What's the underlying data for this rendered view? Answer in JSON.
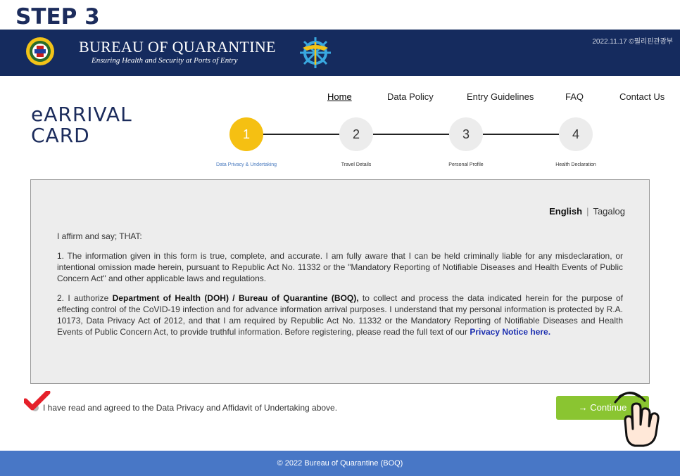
{
  "step_title": "STEP 3",
  "banner": {
    "name": "BUREAU OF QUARANTINE",
    "tagline": "Ensuring Health and Security at Ports of Entry",
    "date": "2022.11.17 ©필리핀관광부"
  },
  "brand": {
    "line1": "eARRIVAL",
    "line2": "CARD"
  },
  "nav": {
    "home": "Home",
    "data_policy": "Data Policy",
    "entry_guidelines": "Entry Guidelines",
    "faq": "FAQ",
    "contact": "Contact Us"
  },
  "stepper": {
    "steps": [
      {
        "num": "1",
        "label": "Data Privacy & Undertaking",
        "active": true
      },
      {
        "num": "2",
        "label": "Travel Details",
        "active": false
      },
      {
        "num": "3",
        "label": "Personal Profile",
        "active": false
      },
      {
        "num": "4",
        "label": "Health Declaration",
        "active": false
      }
    ]
  },
  "panel": {
    "lang_en": "English",
    "lang_sep": "|",
    "lang_tl": "Tagalog",
    "intro": "I affirm and say; THAT:",
    "para1": "1. The information given in this form is true, complete, and accurate. I am fully aware that I can be held criminally liable for any misdeclaration, or intentional omission made herein, pursuant to Republic Act No. 11332 or the \"Mandatory Reporting of Notifiable Diseases and Health Events of Public Concern Act\" and other applicable laws and regulations.",
    "para2_a": "2. I authorize ",
    "para2_bold": "Department of Health (DOH) / Bureau of Quarantine (BOQ),",
    "para2_b": " to collect and process the data indicated herein for the purpose of effecting control of the CoVID-19 infection and for advance information arrival purposes. I understand that my personal information is protected by R.A. 10173, Data Privacy Act of 2012, and that I am required by Republic Act No. 11332 or the Mandatory Reporting of Notifiable Diseases and Health Events of Public Concern Act, to provide truthful information. Before registering, please read the full text of our ",
    "para2_link": "Privacy Notice here."
  },
  "agree_text": "I have read and agreed to the Data Privacy and Affidavit of Undertaking above.",
  "continue_label": "→ Continue",
  "footer": "© 2022 Bureau of Quarantine (BOQ)",
  "colors": {
    "navy": "#152b5e",
    "accent_yellow": "#f5c012",
    "button_green": "#8ac531",
    "footer_blue": "#4877c6"
  }
}
